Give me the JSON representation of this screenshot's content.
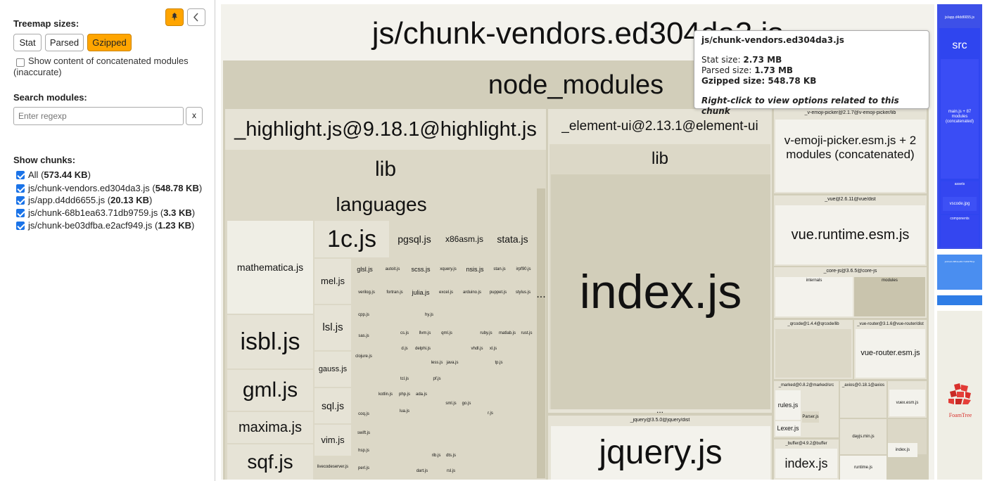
{
  "sidebar": {
    "treemap_sizes_title": "Treemap sizes:",
    "size_buttons": [
      "Stat",
      "Parsed",
      "Gzipped"
    ],
    "active_size": "Gzipped",
    "concat_label": "Show content of concatenated modules (inaccurate)",
    "search_title": "Search modules:",
    "search_placeholder": "Enter regexp",
    "search_clear": "x",
    "chunks_title": "Show chunks:",
    "chunks": [
      {
        "name": "All",
        "size": "573.44 KB"
      },
      {
        "name": "js/chunk-vendors.ed304da3.js",
        "size": "548.78 KB"
      },
      {
        "name": "js/app.d4dd6655.js",
        "size": "20.13 KB"
      },
      {
        "name": "js/chunk-68b1ea63.71db9759.js",
        "size": "3.3 KB"
      },
      {
        "name": "js/chunk-be03dfba.e2acf949.js",
        "size": "1.23 KB"
      }
    ]
  },
  "treemap": {
    "vendors_title": "js/chunk-vendors.ed304da3.js",
    "node_modules": "node_modules",
    "highlight_pkg": "_highlight.js@9.18.1@highlight.js",
    "highlight_lib": "lib",
    "languages": "languages",
    "lang_files_big": [
      "mathematica.js",
      "1c.js",
      "pgsql.js",
      "x86asm.js",
      "stata.js",
      "mel.js",
      "isbl.js",
      "lsl.js",
      "gml.js",
      "gauss.js",
      "sql.js",
      "maxima.js",
      "vim.js",
      "sqf.js"
    ],
    "lang_files_small": [
      "glsl.js",
      "autoit.js",
      "scss.js",
      "xquery.js",
      "nsis.js",
      "stan.js",
      "irpf90.js",
      "verilog.js",
      "fortran.js",
      "julia.js",
      "excel.js",
      "arduino.js",
      "puppet.js",
      "stylus.js",
      "cpp.js",
      "hy.js",
      "sas.js",
      "cs.js",
      "llvm.js",
      "qml.js",
      "ruby.js",
      "matlab.js",
      "rust.js",
      "d.js",
      "delphi.js",
      "xl.js",
      "clojure.js",
      "tcl.js",
      "pf.js",
      "ada.js",
      "php.js",
      "kotlin.js",
      "coq.js",
      "lua.js",
      "sml.js",
      "swift.js",
      "hsp.js",
      "perl.js",
      "dart.js",
      "rsl.js",
      "r.js",
      "tp.js",
      "less.js",
      "java.js",
      "vhdl.js",
      "rib.js",
      "dts.js",
      "go.js",
      "livecodeserver.js"
    ],
    "ellipsis": "...",
    "element_pkg": "_element-ui@2.13.1@element-ui",
    "element_lib": "lib",
    "element_index": "index.js",
    "jquery_pkg": "_jquery@3.5.0@jquery/dist",
    "jquery_file": "jquery.js",
    "emoji_pkg": "_v-emoji-picker@2.1.7@v-emoji-picker/lib",
    "emoji_file": "v-emoji-picker.esm.js + 2 modules (concatenated)",
    "vue_pkg": "_vue@2.6.11@vue/dist",
    "vue_file": "vue.runtime.esm.js",
    "corejs_pkg": "_core-js@3.6.5@core-js",
    "corejs_internals": "internals",
    "corejs_modules": "modules",
    "qrcode_pkg": "_qrcode@1.4.4@qrcode/lib",
    "vuerouter_pkg": "_vue-router@3.1.6@vue-router/dist",
    "vuerouter_file": "vue-router.esm.js",
    "marked_pkg": "_marked@0.8.2@marked/src",
    "marked_rules": "rules.js",
    "marked_parser": "Parser.js",
    "marked_lexer": "Lexer.js",
    "axios_pkg": "_axios@0.18.1@axios",
    "vuex_file": "vuex.esm.js",
    "dayjs_file": "dayjs.min.js",
    "buffer_pkg": "_buffer@4.9.2@buffer",
    "buffer_index": "index.js",
    "runtime_file": "runtime.js",
    "index_small": "index.js",
    "app_title": "js/app.d4dd6655.js",
    "app_src": "src",
    "app_main": "main.js + 87 modules (concatenated)",
    "app_assets": "assets",
    "app_vscode": "vscode.jpg",
    "app_components": "components",
    "chunk68_label": "js/chunk-68b1ea63.71db9759.js",
    "logo_text": "FoamTree"
  },
  "tooltip": {
    "title": "js/chunk-vendors.ed304da3.js",
    "stat_label": "Stat size:",
    "stat_value": "2.73 MB",
    "parsed_label": "Parsed size:",
    "parsed_value": "1.73 MB",
    "gzip_label": "Gzipped size:",
    "gzip_value": "548.78 KB",
    "hint": "Right-click to view options related to this chunk"
  },
  "colors": {
    "accent": "#ffa500",
    "app_chunk": "#3d50e8",
    "chunk68": "#4a8ef0",
    "chunk_be": "#2f7de6"
  }
}
